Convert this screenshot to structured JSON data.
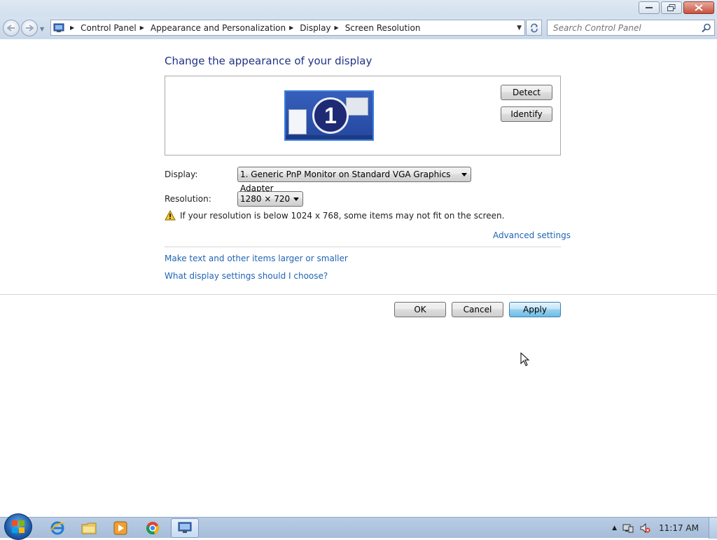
{
  "window": {
    "minimize_label": "Minimize",
    "maximize_label": "Restore",
    "close_label": "Close"
  },
  "address_bar": {
    "breadcrumbs": [
      "Control Panel",
      "Appearance and Personalization",
      "Display",
      "Screen Resolution"
    ]
  },
  "search": {
    "placeholder": "Search Control Panel"
  },
  "content": {
    "heading": "Change the appearance of your display",
    "monitor_number": "1",
    "detect_label": "Detect",
    "identify_label": "Identify",
    "display_label": "Display:",
    "display_value": "1. Generic PnP Monitor on Standard VGA Graphics Adapter",
    "resolution_label": "Resolution:",
    "resolution_value": "1280 × 720",
    "warning_text": "If your resolution is below 1024 x 768, some items may not fit on the screen.",
    "advanced_settings": "Advanced settings",
    "link_text_size": "Make text and other items larger or smaller",
    "link_which_settings": "What display settings should I choose?",
    "ok_label": "OK",
    "cancel_label": "Cancel",
    "apply_label": "Apply"
  },
  "taskbar": {
    "items": [
      "internet-explorer",
      "windows-explorer",
      "media-player",
      "chrome",
      "control-panel"
    ],
    "clock": "11:17 AM"
  },
  "colors": {
    "heading": "#1e3287",
    "link": "#1f64b4",
    "taskbar": "#b0c5de"
  }
}
